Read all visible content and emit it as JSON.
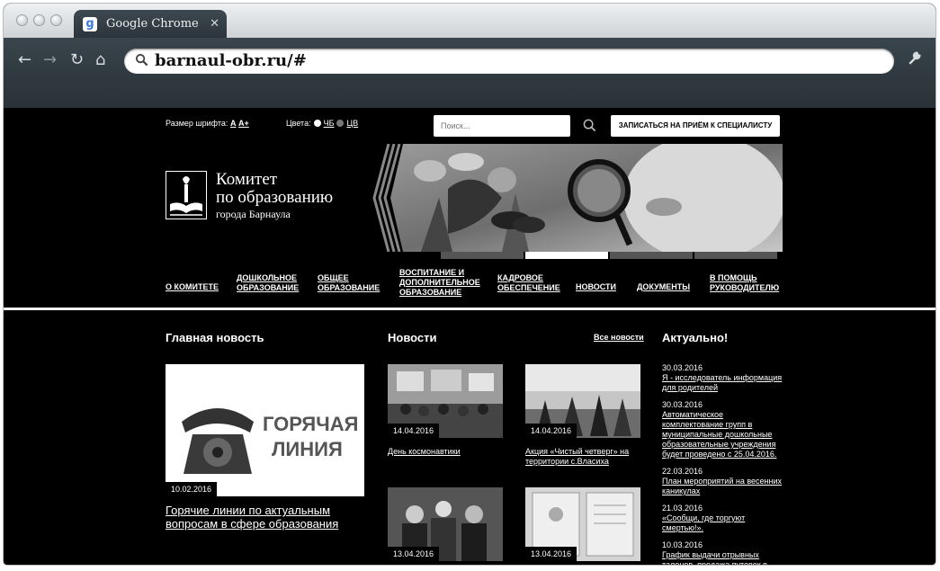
{
  "browser": {
    "tab_title": "Google Chrome",
    "tab_close": "✕",
    "url": "barnaul-obr.ru/#",
    "icons": [
      "back-icon",
      "forward-icon",
      "reload-icon",
      "home-icon",
      "search-icon",
      "wrench-icon"
    ]
  },
  "header": {
    "font_size_label": "Размер шрифта:",
    "font_size_a": "A",
    "font_size_aplus": "A+",
    "colors_label": "Цвета:",
    "bw_label": "ЧБ",
    "color_label": "ЦВ",
    "search_placeholder": "Поиск...",
    "appointment_button": "ЗАПИСАТЬСЯ НА ПРИЁМ К СПЕЦИАЛИСТУ"
  },
  "logo": {
    "line1": "Комитет",
    "line2": "по образованию",
    "line3": "города Барнаула"
  },
  "slider": {
    "count": 4,
    "active_index": 1
  },
  "nav": [
    {
      "l1": "О КОМИТЕТЕ",
      "l2": "",
      "l3": ""
    },
    {
      "l1": "ДОШКОЛЬНОЕ",
      "l2": "ОБРАЗОВАНИЕ",
      "l3": ""
    },
    {
      "l1": "ОБЩЕЕ",
      "l2": "ОБРАЗОВАНИЕ",
      "l3": ""
    },
    {
      "l1": "ВОСПИТАНИЕ И",
      "l2": "ДОПОЛНИТЕЛЬНОЕ",
      "l3": "ОБРАЗОВАНИЕ"
    },
    {
      "l1": "КАДРОВОЕ",
      "l2": "ОБЕСПЕЧЕНИЕ",
      "l3": ""
    },
    {
      "l1": "НОВОСТИ",
      "l2": "",
      "l3": ""
    },
    {
      "l1": "ДОКУМЕНТЫ",
      "l2": "",
      "l3": ""
    },
    {
      "l1": "В ПОМОЩЬ",
      "l2": "РУКОВОДИТЕЛЮ",
      "l3": ""
    }
  ],
  "main_news": {
    "heading": "Главная новость",
    "image_text_l1": "ГОРЯЧАЯ",
    "image_text_l2": "ЛИНИЯ",
    "date": "10.02.2016",
    "title": "Горячие линии по актуальным вопросам в сфере образования"
  },
  "news": {
    "heading": "Новости",
    "all_link": "Все новости",
    "items": [
      {
        "date": "14.04.2016",
        "title": "День космонавтики"
      },
      {
        "date": "14.04.2016",
        "title": "Акция «Чистый четверг» на территории с.Власиха"
      },
      {
        "date": "13.04.2016",
        "title": ""
      },
      {
        "date": "13.04.2016",
        "title": ""
      }
    ]
  },
  "actual": {
    "heading": "Актуально!",
    "items": [
      {
        "date": "30.03.2016",
        "title": "Я - исследователь информация для родителей"
      },
      {
        "date": "30.03.2016",
        "title": "Автоматическое комплектование групп в муниципальные дошкольные образовательные учреждения будет проведено с 25.04.2016."
      },
      {
        "date": "22.03.2016",
        "title": "План мероприятий на весенних каникулах"
      },
      {
        "date": "21.03.2016",
        "title": "«Сообщи, где торгуют смертью!»."
      },
      {
        "date": "10.03.2016",
        "title": "График выдачи отрывных талонов, продажа путевок в"
      }
    ]
  }
}
